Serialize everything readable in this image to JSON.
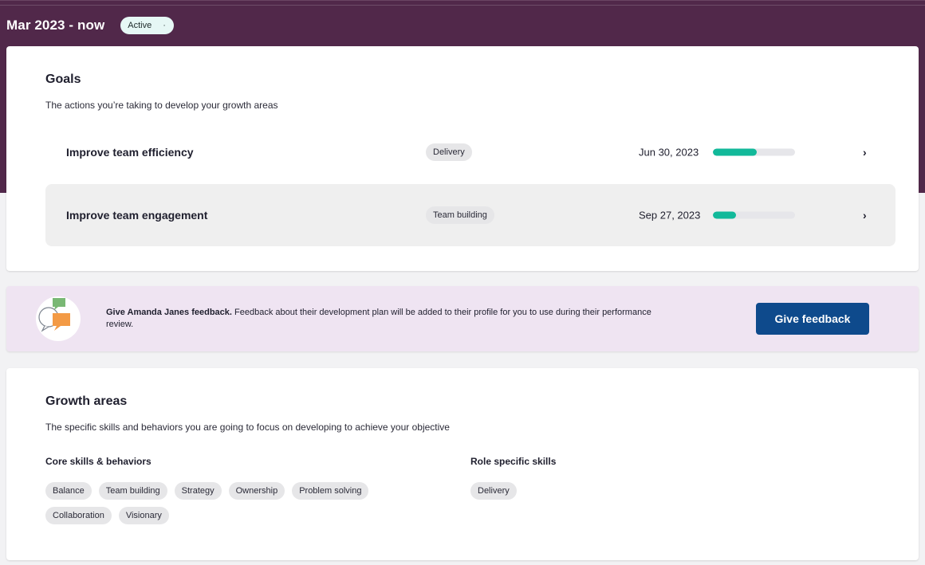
{
  "header": {
    "period": "Mar 2023 - now",
    "status": "Active",
    "status_dot": "·"
  },
  "goals": {
    "title": "Goals",
    "subtitle": "The actions you’re taking to develop your growth areas",
    "items": [
      {
        "name": "Improve team efficiency",
        "tag": "Delivery",
        "due": "Jun 30, 2023",
        "progress": 0.53,
        "chevron": "›"
      },
      {
        "name": "Improve team engagement",
        "tag": "Team building",
        "due": "Sep 27, 2023",
        "progress": 0.28,
        "chevron": "›"
      }
    ]
  },
  "feedback": {
    "lead": "Give Amanda Janes feedback.",
    "body": " Feedback about their development plan will be added to their profile for you to use during their performance review.",
    "button": "Give feedback"
  },
  "growth": {
    "title": "Growth areas",
    "subtitle": "The specific skills and behaviors you are going to focus on developing to achieve your objective",
    "core_heading": "Core skills & behaviors",
    "core": [
      "Balance",
      "Team building",
      "Strategy",
      "Ownership",
      "Problem solving",
      "Collaboration",
      "Visionary"
    ],
    "role_heading": "Role specific skills",
    "role": [
      "Delivery"
    ]
  },
  "colors": {
    "hero": "#51284a",
    "progress": "#12b99a",
    "button": "#0e4a8c",
    "banner": "#efe4f2"
  }
}
